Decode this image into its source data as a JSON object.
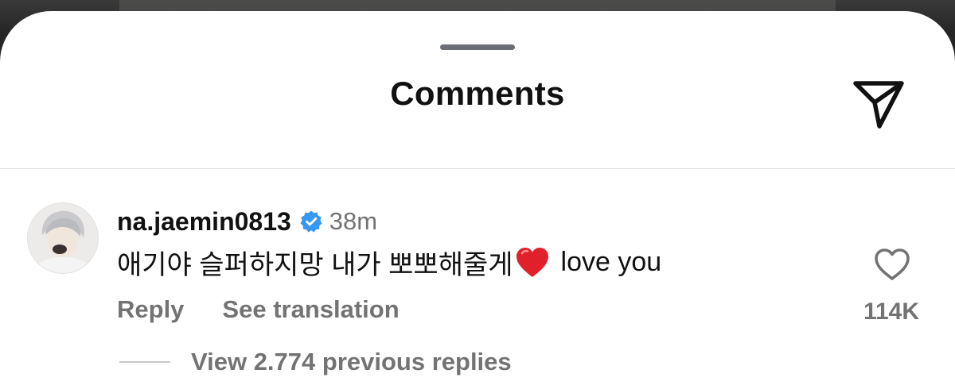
{
  "sheet": {
    "title": "Comments"
  },
  "comment": {
    "username": "na.jaemin0813",
    "verified": true,
    "timestamp": "38m",
    "text_korean": "애기야 슬퍼하지망 내가 뽀뽀해줄게",
    "emoji": "red-heart-emoji",
    "text_english": "love you",
    "reply_label": "Reply",
    "translate_label": "See translation",
    "like_count": "114K",
    "view_replies_label": "View 2.774 previous replies"
  },
  "colors": {
    "background": "#ffffff",
    "primary_text": "#111111",
    "secondary_text": "#737373",
    "divider": "#dbdbdb",
    "verified_badge": "#3897f0",
    "heart_emoji": "#e0212b"
  },
  "icons": {
    "share": "paper-plane-icon",
    "verified": "verified-badge-icon",
    "like": "heart-outline-icon"
  }
}
